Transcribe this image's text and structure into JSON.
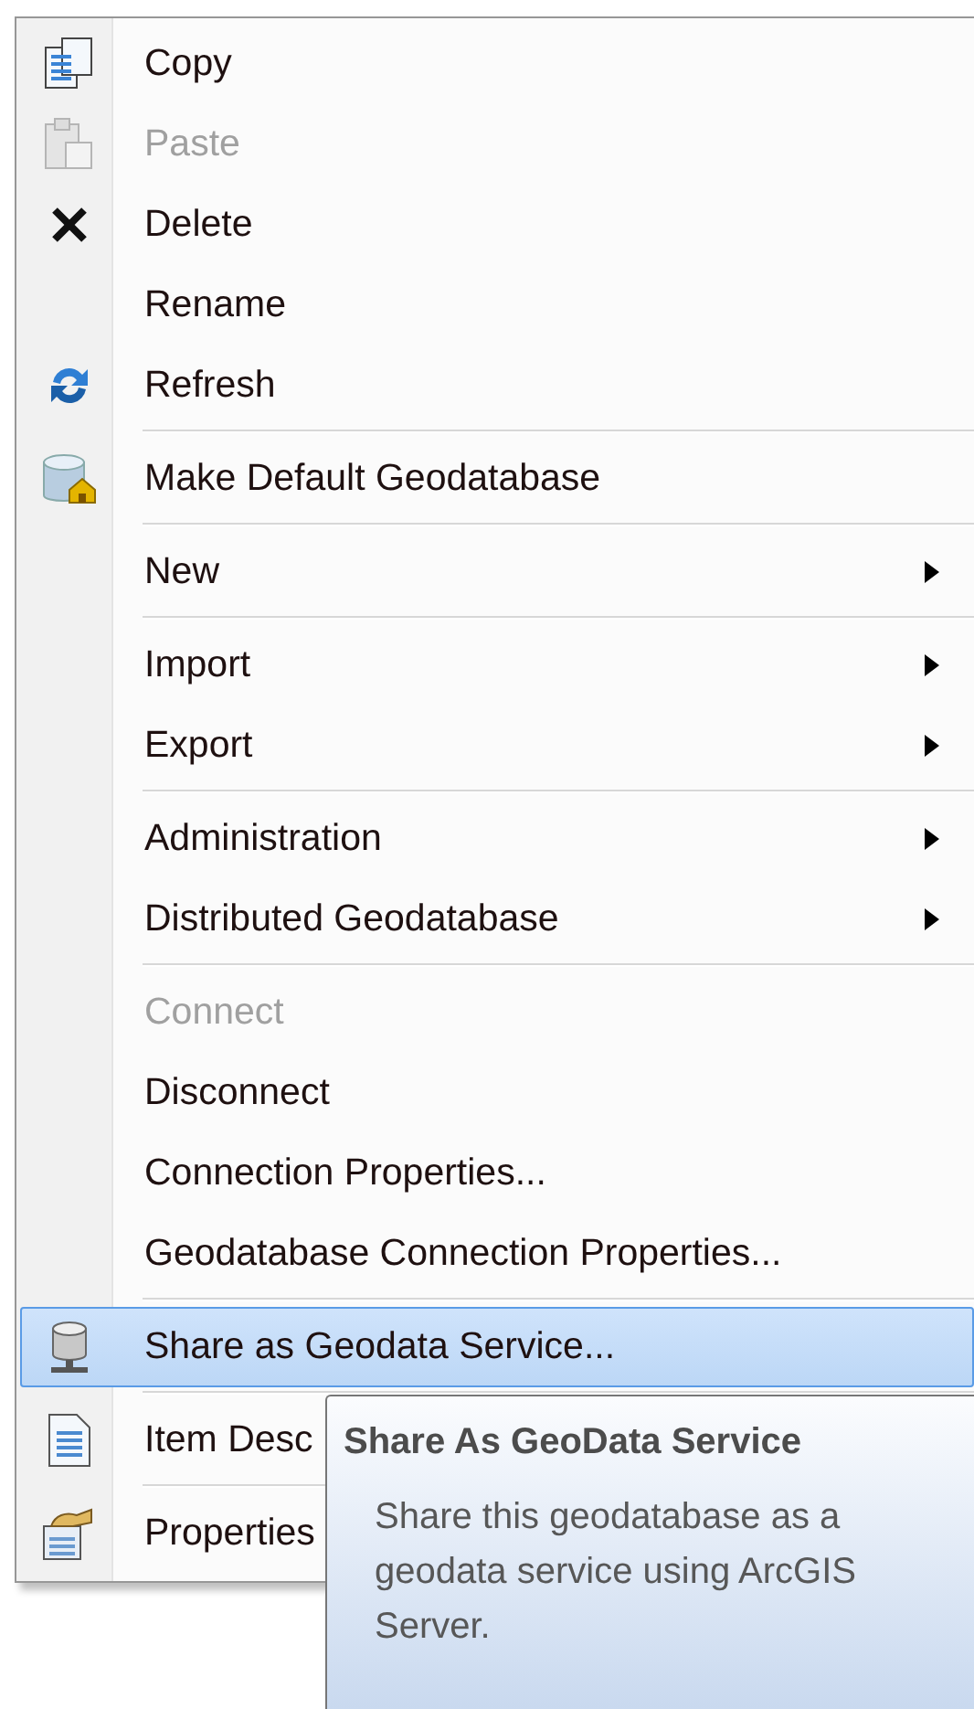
{
  "menu": {
    "items": [
      {
        "kind": "item",
        "label": "Copy",
        "disabled": false,
        "selected": false,
        "submenu": false
      },
      {
        "kind": "item",
        "label": "Paste",
        "disabled": true,
        "selected": false,
        "submenu": false
      },
      {
        "kind": "item",
        "label": "Delete",
        "disabled": false,
        "selected": false,
        "submenu": false
      },
      {
        "kind": "item",
        "label": "Rename",
        "disabled": false,
        "selected": false,
        "submenu": false
      },
      {
        "kind": "item",
        "label": "Refresh",
        "disabled": false,
        "selected": false,
        "submenu": false
      },
      {
        "kind": "separator"
      },
      {
        "kind": "item",
        "label": "Make Default Geodatabase",
        "disabled": false,
        "selected": false,
        "submenu": false
      },
      {
        "kind": "separator"
      },
      {
        "kind": "item",
        "label": "New",
        "disabled": false,
        "selected": false,
        "submenu": true
      },
      {
        "kind": "separator"
      },
      {
        "kind": "item",
        "label": "Import",
        "disabled": false,
        "selected": false,
        "submenu": true
      },
      {
        "kind": "item",
        "label": "Export",
        "disabled": false,
        "selected": false,
        "submenu": true
      },
      {
        "kind": "separator"
      },
      {
        "kind": "item",
        "label": "Administration",
        "disabled": false,
        "selected": false,
        "submenu": true
      },
      {
        "kind": "item",
        "label": "Distributed Geodatabase",
        "disabled": false,
        "selected": false,
        "submenu": true
      },
      {
        "kind": "separator"
      },
      {
        "kind": "item",
        "label": "Connect",
        "disabled": true,
        "selected": false,
        "submenu": false
      },
      {
        "kind": "item",
        "label": "Disconnect",
        "disabled": false,
        "selected": false,
        "submenu": false
      },
      {
        "kind": "item",
        "label": "Connection Properties...",
        "disabled": false,
        "selected": false,
        "submenu": false
      },
      {
        "kind": "item",
        "label": "Geodatabase Connection Properties...",
        "disabled": false,
        "selected": false,
        "submenu": false
      },
      {
        "kind": "separator"
      },
      {
        "kind": "item",
        "label": "Share as Geodata Service...",
        "disabled": false,
        "selected": true,
        "submenu": false
      },
      {
        "kind": "separator"
      },
      {
        "kind": "item",
        "label": "Item Desc",
        "disabled": false,
        "selected": false,
        "submenu": false
      },
      {
        "kind": "separator"
      },
      {
        "kind": "item",
        "label": "Properties",
        "disabled": false,
        "selected": false,
        "submenu": false
      }
    ]
  },
  "tooltip": {
    "title": "Share As GeoData Service",
    "text": "Share this geodatabase as a geodata service using ArcGIS Server."
  }
}
